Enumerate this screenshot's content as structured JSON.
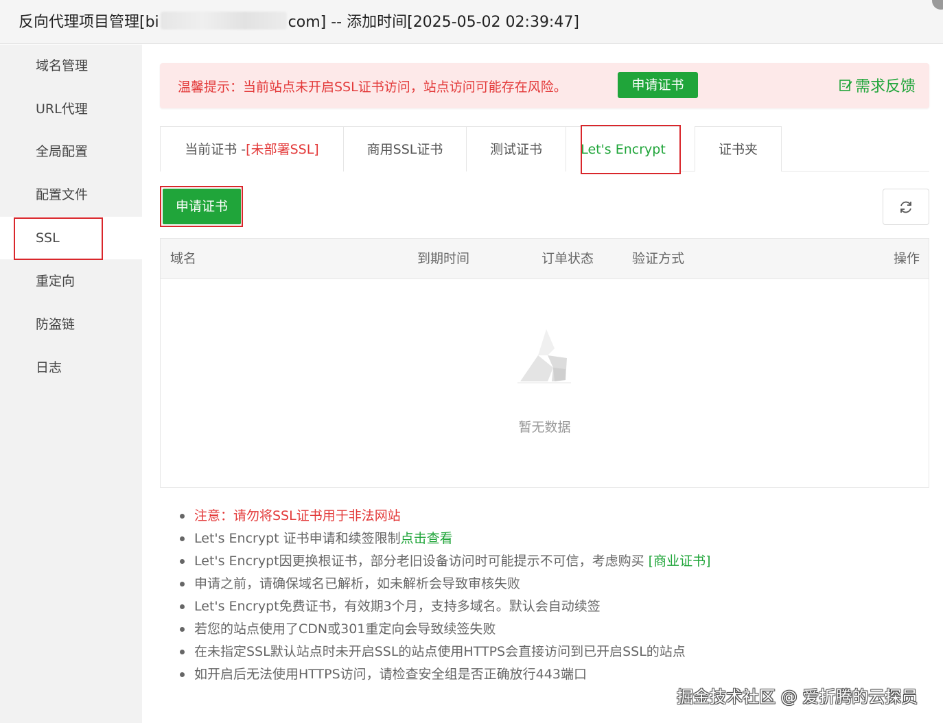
{
  "window": {
    "title_prefix": "反向代理项目管理[bi",
    "title_suffix": "com] -- 添加时间[2025-05-02 02:39:47]"
  },
  "sidebar": {
    "items": [
      {
        "label": "域名管理"
      },
      {
        "label": "URL代理"
      },
      {
        "label": "全局配置"
      },
      {
        "label": "配置文件"
      },
      {
        "label": "SSL"
      },
      {
        "label": "重定向"
      },
      {
        "label": "防盗链"
      },
      {
        "label": "日志"
      }
    ],
    "active": "SSL"
  },
  "alert": {
    "text": "温馨提示：当前站点未开启SSL证书访问，站点访问可能存在风险。",
    "button": "申请证书",
    "feedback": "需求反馈"
  },
  "tabs": {
    "current_cert_label": "当前证书 -",
    "current_cert_status": "[未部署SSL]",
    "commercial": "商用SSL证书",
    "test": "测试证书",
    "letsencrypt": "Let's Encrypt",
    "folder": "证书夹",
    "active": "Let's Encrypt"
  },
  "toolbar": {
    "apply_button": "申请证书"
  },
  "table": {
    "columns": [
      "域名",
      "到期时间",
      "订单状态",
      "验证方式",
      "操作"
    ],
    "empty_text": "暂无数据"
  },
  "notes": {
    "items": [
      "注意：请勿将SSL证书用于非法网站",
      "Let's Encrypt 证书申请和续签限制",
      "Let's Encrypt因更换根证书，部分老旧设备访问时可能提示不可信，考虑购买 ",
      "申请之前，请确保域名已解析，如未解析会导致审核失败",
      "Let's Encrypt免费证书，有效期3个月，支持多域名。默认会自动续签",
      "若您的站点使用了CDN或301重定向会导致续签失败",
      "在未指定SSL默认站点时未开启SSL的站点使用HTTPS会直接访问到已开启SSL的站点",
      "如开启后无法使用HTTPS访问，请检查安全组是否正确放行443端口"
    ],
    "link_view": "点击查看",
    "link_commercial": "[商业证书]"
  },
  "watermark": "掘金技术社区 @ 爱折腾的云探员",
  "colors": {
    "accent_green": "#20a53a",
    "warning_red": "#e33a3a",
    "highlight_border": "#d9262b",
    "alert_bg": "#fde9e9"
  },
  "icons": {
    "feedback": "edit-icon",
    "refresh": "refresh-icon",
    "empty": "empty-box-icon"
  }
}
